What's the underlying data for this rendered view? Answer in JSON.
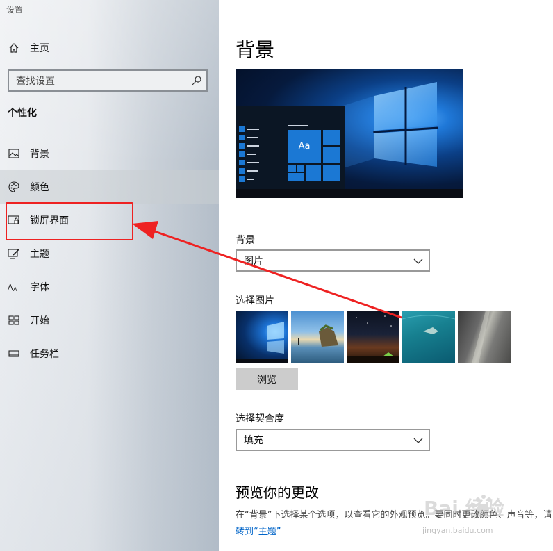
{
  "window": {
    "title": "设置"
  },
  "sidebar": {
    "home_label": "主页",
    "search_placeholder": "查找设置",
    "section_heading": "个性化",
    "items": [
      {
        "label": "背景",
        "icon": "image-icon"
      },
      {
        "label": "颜色",
        "icon": "palette-icon"
      },
      {
        "label": "锁屏界面",
        "icon": "lock-screen-icon"
      },
      {
        "label": "主题",
        "icon": "brush-icon"
      },
      {
        "label": "字体",
        "icon": "font-icon"
      },
      {
        "label": "开始",
        "icon": "start-grid-icon"
      },
      {
        "label": "任务栏",
        "icon": "taskbar-icon"
      }
    ],
    "selected_index": 1
  },
  "main": {
    "title": "背景",
    "preview": {
      "tile_text": "Aa"
    },
    "background_label": "背景",
    "background_value": "图片",
    "choose_picture_label": "选择图片",
    "browse_button": "浏览",
    "fit_label": "选择契合度",
    "fit_value": "填充",
    "preview_changes_heading": "预览你的更改",
    "description": "在“背景”下选择某个选项，以查看它的外观预览。要同时更改颜色、声音等，请",
    "link": "转到“主题”"
  },
  "watermark": {
    "text": "Bai 经验",
    "url": "jingyan.baidu.com"
  },
  "annotation": {
    "color": "#ee2222"
  },
  "colors": {
    "accent": "#0064c8",
    "tile_blue": "#1b78d4"
  }
}
